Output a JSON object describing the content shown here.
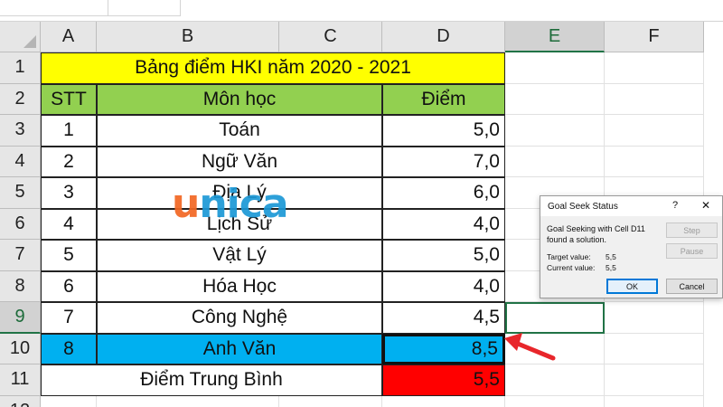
{
  "columns": [
    "A",
    "B",
    "C",
    "D",
    "E",
    "F"
  ],
  "rows": [
    "1",
    "2",
    "3",
    "4",
    "5",
    "6",
    "7",
    "8",
    "9",
    "10",
    "11",
    "12"
  ],
  "sheet": {
    "title": "Bảng điểm HKI năm 2020 - 2021",
    "headers": {
      "stt": "STT",
      "subject": "Môn học",
      "score": "Điểm"
    },
    "records": [
      {
        "stt": "1",
        "subject": "Toán",
        "score": "5,0"
      },
      {
        "stt": "2",
        "subject": "Ngữ Văn",
        "score": "7,0"
      },
      {
        "stt": "3",
        "subject": "Địa Lý",
        "score": "6,0"
      },
      {
        "stt": "4",
        "subject": "Lịch Sử",
        "score": "4,0"
      },
      {
        "stt": "5",
        "subject": "Vật Lý",
        "score": "5,0"
      },
      {
        "stt": "6",
        "subject": "Hóa Học",
        "score": "4,0"
      },
      {
        "stt": "7",
        "subject": "Công Nghệ",
        "score": "4,5"
      },
      {
        "stt": "8",
        "subject": "Anh Văn",
        "score": "8,5"
      }
    ],
    "average_label": "Điểm Trung Bình",
    "average_value": "5,5"
  },
  "watermark": {
    "first": "u",
    "rest": "nica"
  },
  "dialog": {
    "title": "Goal Seek Status",
    "help": "?",
    "close": "✕",
    "message": "Goal Seeking with Cell D11 found a solution.",
    "target_label": "Target value:",
    "target_value": "5,5",
    "current_label": "Current value:",
    "current_value": "5,5",
    "step_label": "Step",
    "pause_label": "Pause",
    "ok_label": "OK",
    "cancel_label": "Cancel"
  },
  "colors": {
    "title_fill": "#ffff00",
    "header_fill": "#92d050",
    "selected_row_fill": "#00b0f0",
    "average_fill": "#ff0000",
    "arrow": "#e8262b"
  },
  "icons": {
    "annotation": "red-arrow-icon",
    "select_all": "select-all-icon"
  }
}
